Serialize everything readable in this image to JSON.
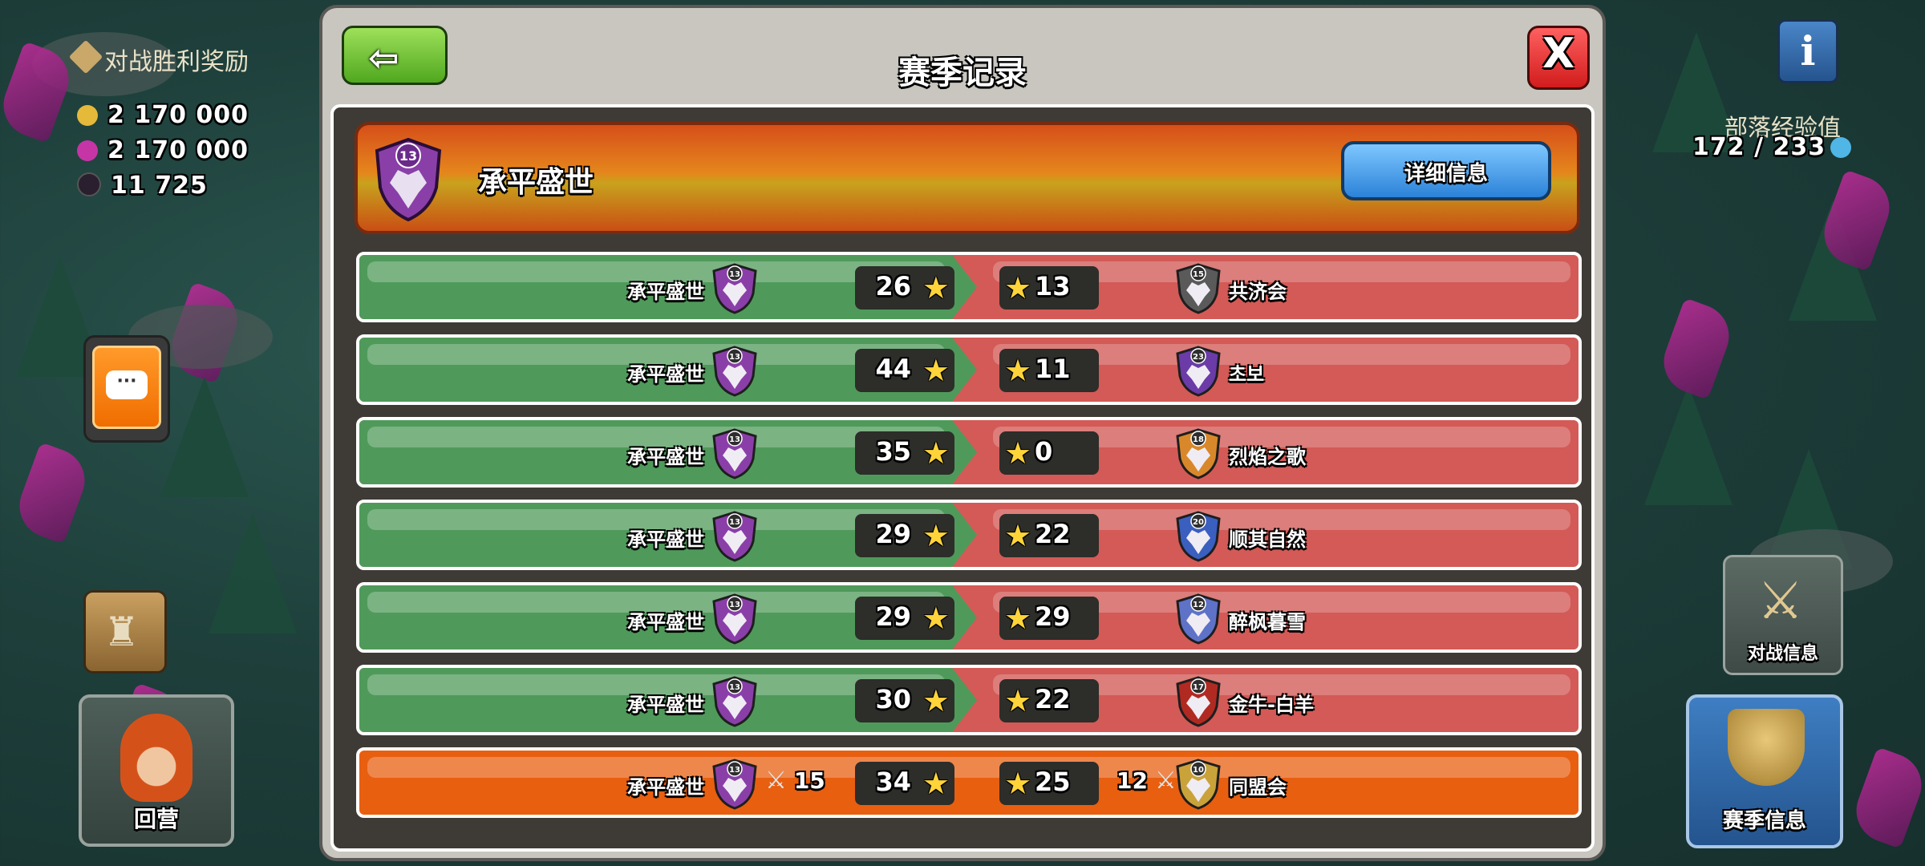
{
  "background": {
    "reward_title": "对战胜利奖励",
    "rewards": [
      {
        "icon": "gold-coin-icon",
        "color": "#e5b93a",
        "value": "2 170 000"
      },
      {
        "icon": "elixir-drop-icon",
        "color": "#c535a6",
        "value": "2 170 000"
      },
      {
        "icon": "dark-elixir-icon",
        "color": "#2a1f2e",
        "value": "11 725"
      }
    ],
    "xp_label": "部落经验值",
    "xp_value": "172 / 233",
    "village_label": "回营",
    "war_info_label": "对战信息",
    "season_info_label": "赛季信息"
  },
  "dialog": {
    "title": "赛季记录",
    "close_label": "X",
    "back_arrow": "⇦",
    "clan": {
      "name": "承平盛世",
      "level": "13"
    },
    "details_label": "详细信息"
  },
  "wars": [
    {
      "my_clan": "承平盛世",
      "my_level": "13",
      "my_stars": "26",
      "opp_stars": "13",
      "opp_level": "15",
      "opp_clan": "共济会",
      "opp_color": "#5a5a5a"
    },
    {
      "my_clan": "承平盛世",
      "my_level": "13",
      "my_stars": "44",
      "opp_stars": "11",
      "opp_level": "23",
      "opp_clan": "초보",
      "opp_color": "#6b3ba8"
    },
    {
      "my_clan": "承平盛世",
      "my_level": "13",
      "my_stars": "35",
      "opp_stars": "0",
      "opp_level": "18",
      "opp_clan": "烈焰之歌",
      "opp_color": "#d8882a"
    },
    {
      "my_clan": "承平盛世",
      "my_level": "13",
      "my_stars": "29",
      "opp_stars": "22",
      "opp_level": "20",
      "opp_clan": "顺其自然",
      "opp_color": "#3a5fbf"
    },
    {
      "my_clan": "承平盛世",
      "my_level": "13",
      "my_stars": "29",
      "opp_stars": "29",
      "opp_level": "12",
      "opp_clan": "醉枫暮雪",
      "opp_color": "#5e72c8"
    },
    {
      "my_clan": "承平盛世",
      "my_level": "13",
      "my_stars": "30",
      "opp_stars": "22",
      "opp_level": "17",
      "opp_clan": "金牛-白羊",
      "opp_color": "#b02a22"
    }
  ],
  "current_war": {
    "my_clan": "承平盛世",
    "my_level": "13",
    "my_attacks": "15",
    "my_stars": "34",
    "opp_stars": "25",
    "opp_attacks": "12",
    "opp_level": "10",
    "opp_clan": "同盟会",
    "opp_color": "#c9a23a"
  }
}
